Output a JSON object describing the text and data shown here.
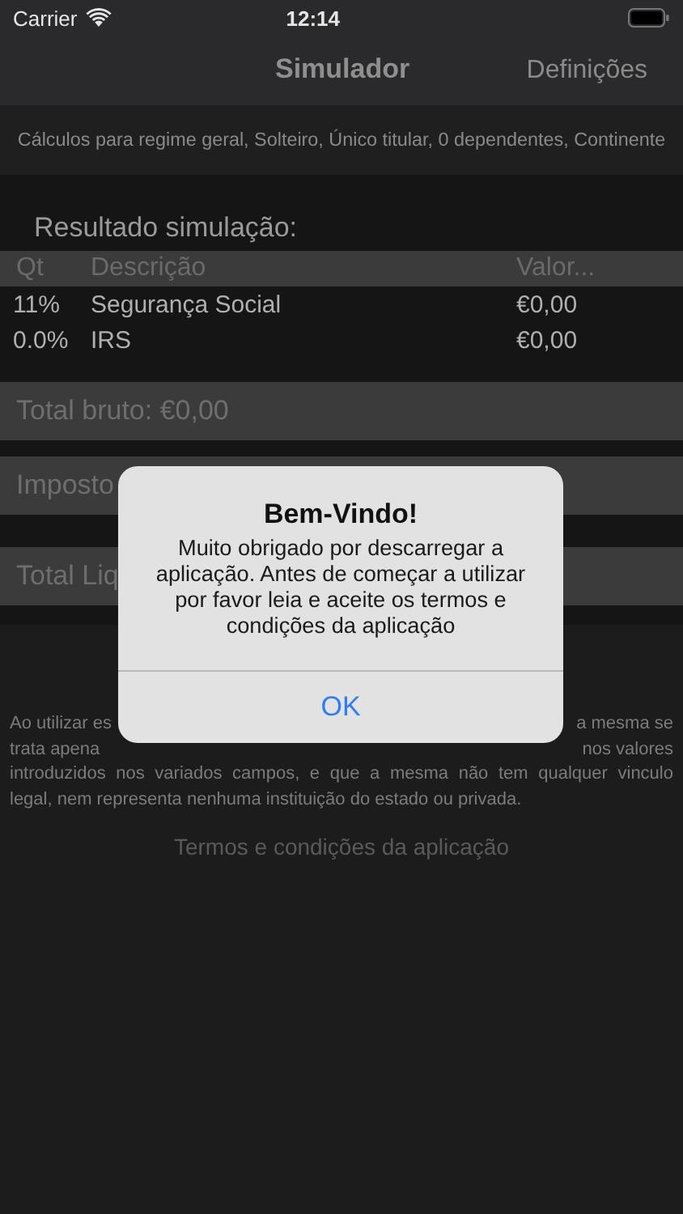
{
  "status_bar": {
    "carrier": "Carrier",
    "time": "12:14"
  },
  "nav_bar": {
    "title": "Simulador",
    "right_button": "Definições"
  },
  "subtitle": "Cálculos para regime geral, Solteiro, Único titular, 0 dependentes, Continente",
  "result_heading": "Resultado simulação:",
  "table": {
    "columns": [
      "Qt",
      "Descrição",
      "Valor..."
    ],
    "rows": [
      [
        "11%",
        "Segurança Social",
        "€0,00"
      ],
      [
        "0.0%",
        "IRS",
        "€0,00"
      ]
    ]
  },
  "totals": [
    "Total bruto: €0,00",
    "Imposto",
    "Total Liq"
  ],
  "disclaimer_lines": [
    {
      "left": "Ao utilizar es",
      "right": "a mesma se"
    },
    {
      "left": "trata apena",
      "right": "nos valores"
    },
    {
      "text": "introduzidos nos variados campos, e que a mesma não tem qualquer vinculo",
      "justify": true
    },
    {
      "text": "legal, nem representa nenhuma instituição do estado ou privada.",
      "justify": false
    }
  ],
  "terms_link": "Termos e condições da aplicação",
  "alert": {
    "title": "Bem-Vindo!",
    "message": "Muito obrigado por descarregar a aplicação. Antes de começar a utilizar por favor leia e aceite os termos e condições da aplicação",
    "button": "OK"
  }
}
